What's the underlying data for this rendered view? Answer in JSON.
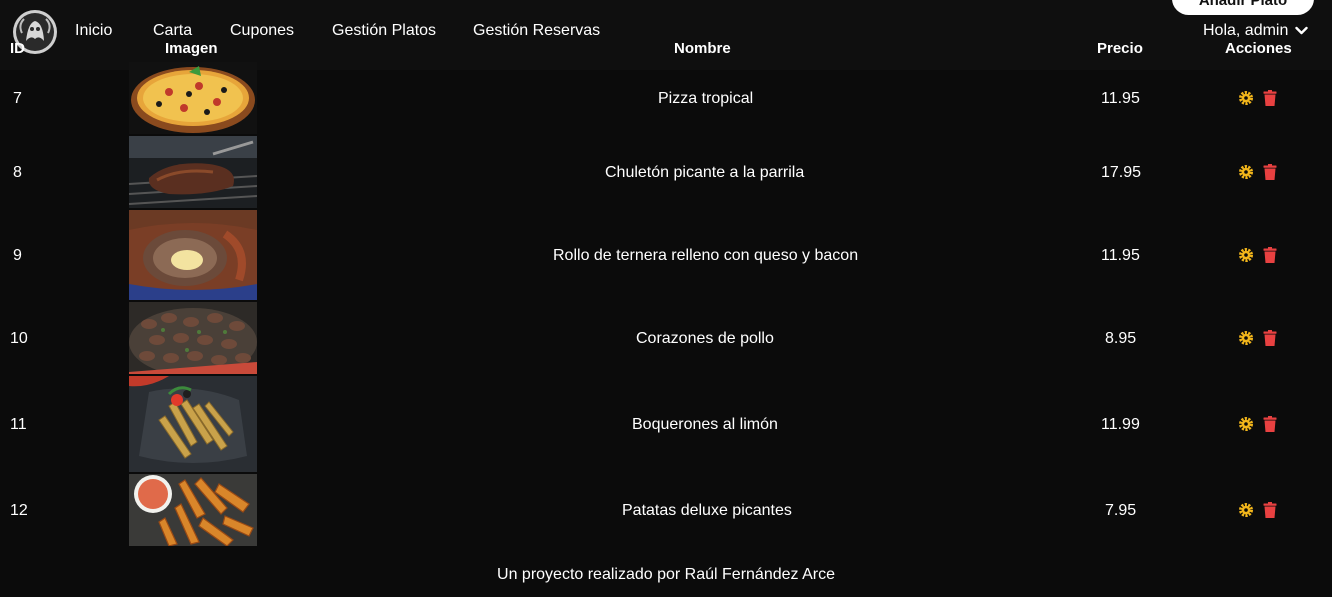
{
  "header": {
    "nav": [
      "Inicio",
      "Carta",
      "Cupones",
      "Gestión Platos",
      "Gestión Reservas"
    ],
    "add_button": "Añadir Plato",
    "user_greeting": "Hola, admin"
  },
  "table": {
    "columns": [
      "ID",
      "Imagen",
      "Nombre",
      "Precio",
      "Acciones"
    ],
    "rows": [
      {
        "id": "7",
        "name": "Pizza tropical",
        "price": "11.95"
      },
      {
        "id": "8",
        "name": "Chuletón picante a la parrila",
        "price": "17.95"
      },
      {
        "id": "9",
        "name": "Rollo de ternera relleno con queso y bacon",
        "price": "11.95"
      },
      {
        "id": "10",
        "name": "Corazones de pollo",
        "price": "8.95"
      },
      {
        "id": "11",
        "name": "Boquerones al limón",
        "price": "11.99"
      },
      {
        "id": "12",
        "name": "Patatas deluxe picantes",
        "price": "7.95"
      }
    ]
  },
  "footer": {
    "text": "Un proyecto realizado por Raúl Fernández Arce"
  },
  "colors": {
    "edit_icon": "#f2b61b",
    "delete_icon": "#e84141"
  }
}
